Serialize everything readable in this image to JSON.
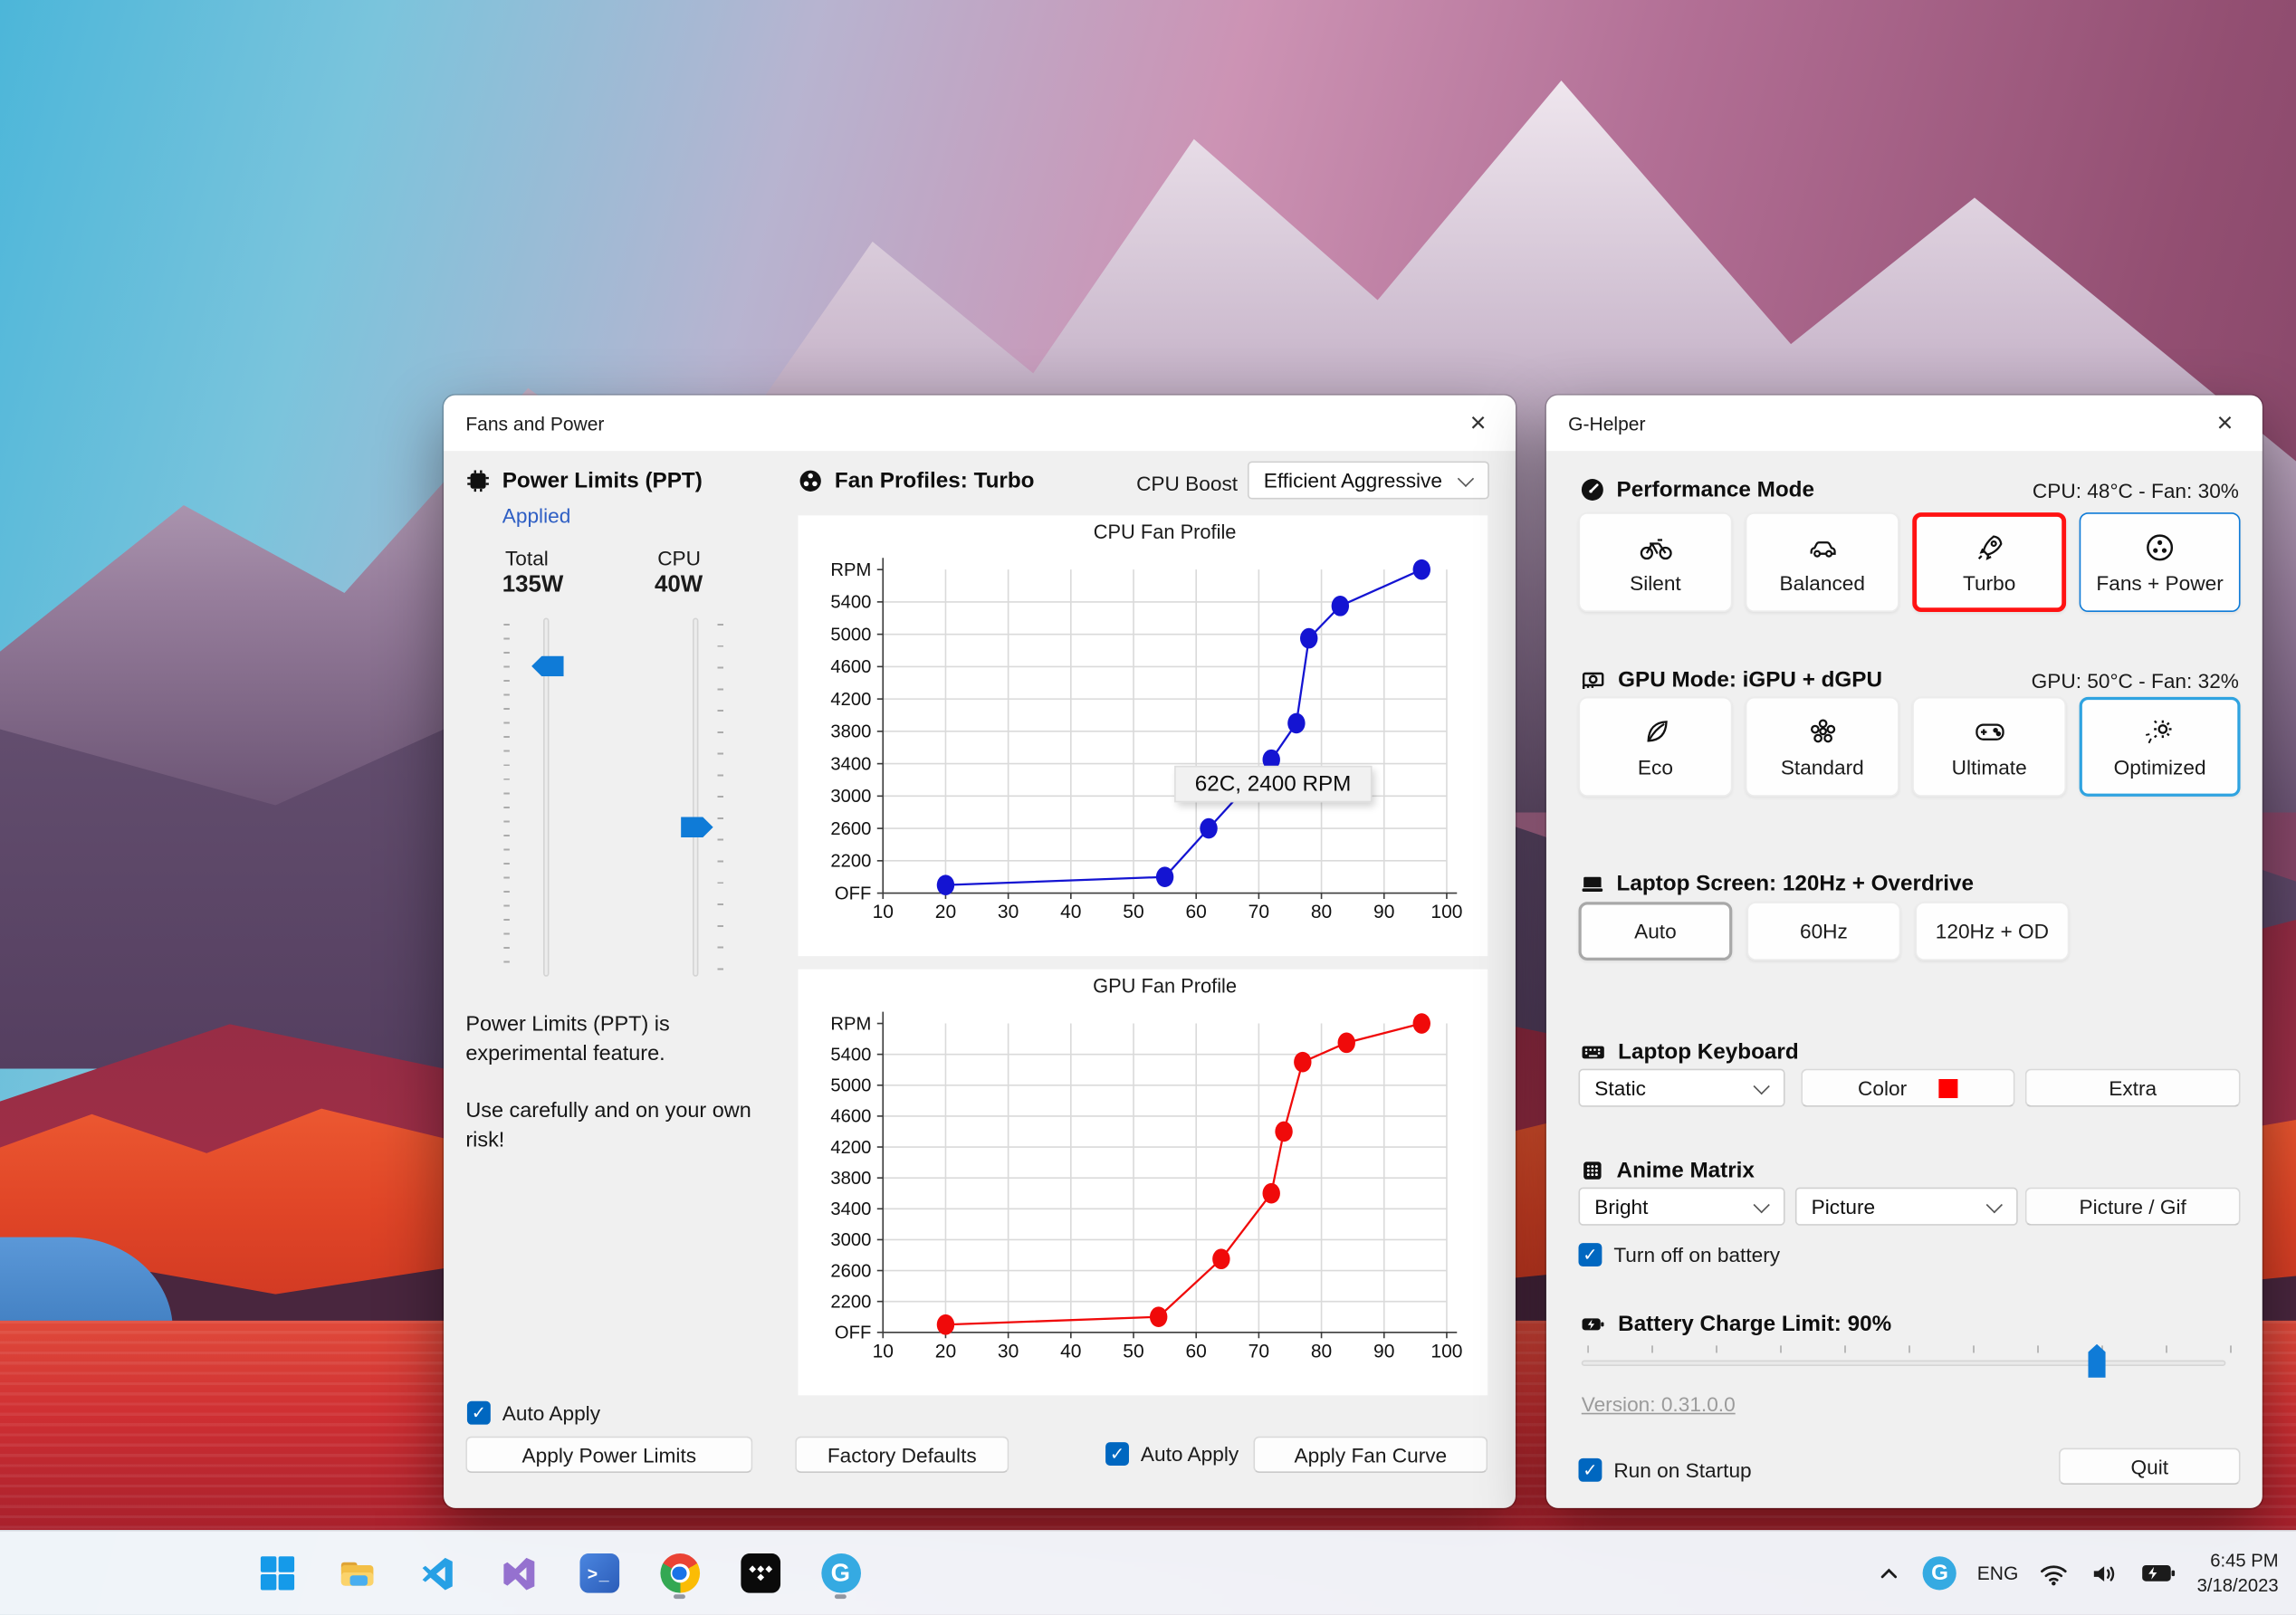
{
  "accent": {
    "blue": "#0f7bd7",
    "checkbox_blue": "#0067c0",
    "selected_red": "#ff1212",
    "selected_blue": "#2fa3e0"
  },
  "fans_window": {
    "title": "Fans and Power",
    "close_glyph": "×",
    "power_limits": {
      "header": "Power Limits (PPT)",
      "status": "Applied",
      "total_label": "Total",
      "total_value": "135W",
      "cpu_label": "CPU",
      "cpu_value": "40W",
      "note1": "Power Limits (PPT) is experimental feature.",
      "note2": "Use carefully and on your own risk!",
      "auto_apply": "Auto Apply",
      "apply_button": "Apply Power Limits"
    },
    "fan_profiles": {
      "header": "Fan Profiles: Turbo",
      "cpu_boost_label": "CPU Boost",
      "cpu_boost_value": "Efficient Aggressive",
      "factory_defaults": "Factory Defaults",
      "auto_apply": "Auto Apply",
      "apply_button": "Apply Fan Curve"
    }
  },
  "chart_data": [
    {
      "id": "cpu",
      "type": "line",
      "title": "CPU Fan Profile",
      "color": "#1414d2",
      "legend_position": "none",
      "grid": true,
      "xlim": [
        10,
        100
      ],
      "ylim": [
        1800,
        5800
      ],
      "x_ticks": [
        10,
        20,
        30,
        40,
        50,
        60,
        70,
        80,
        90,
        100
      ],
      "y_ticks": [
        {
          "v": 1800,
          "label": "OFF"
        },
        {
          "v": 2200,
          "label": "2200"
        },
        {
          "v": 2600,
          "label": "2600"
        },
        {
          "v": 3000,
          "label": "3000"
        },
        {
          "v": 3400,
          "label": "3400"
        },
        {
          "v": 3800,
          "label": "3800"
        },
        {
          "v": 4200,
          "label": "4200"
        },
        {
          "v": 4600,
          "label": "4600"
        },
        {
          "v": 5000,
          "label": "5000"
        },
        {
          "v": 5400,
          "label": "5400"
        },
        {
          "v": 5800,
          "label": "RPM"
        }
      ],
      "points": [
        [
          20,
          1900
        ],
        [
          55,
          2000
        ],
        [
          62,
          2600
        ],
        [
          72,
          3450
        ],
        [
          76,
          3900
        ],
        [
          78,
          4950
        ],
        [
          83,
          5350
        ],
        [
          96,
          5800
        ]
      ],
      "tooltip": "62C, 2400 RPM"
    },
    {
      "id": "gpu",
      "type": "line",
      "title": "GPU Fan Profile",
      "color": "#f00a0a",
      "legend_position": "none",
      "grid": true,
      "xlim": [
        10,
        100
      ],
      "ylim": [
        1800,
        5800
      ],
      "x_ticks": [
        10,
        20,
        30,
        40,
        50,
        60,
        70,
        80,
        90,
        100
      ],
      "y_ticks": [
        {
          "v": 1800,
          "label": "OFF"
        },
        {
          "v": 2200,
          "label": "2200"
        },
        {
          "v": 2600,
          "label": "2600"
        },
        {
          "v": 3000,
          "label": "3000"
        },
        {
          "v": 3400,
          "label": "3400"
        },
        {
          "v": 3800,
          "label": "3800"
        },
        {
          "v": 4200,
          "label": "4200"
        },
        {
          "v": 4600,
          "label": "4600"
        },
        {
          "v": 5000,
          "label": "5000"
        },
        {
          "v": 5400,
          "label": "5400"
        },
        {
          "v": 5800,
          "label": "RPM"
        }
      ],
      "points": [
        [
          20,
          1900
        ],
        [
          54,
          2000
        ],
        [
          64,
          2750
        ],
        [
          72,
          3600
        ],
        [
          74,
          4400
        ],
        [
          77,
          5300
        ],
        [
          84,
          5550
        ],
        [
          96,
          5800
        ]
      ]
    }
  ],
  "ghelper": {
    "title": "G-Helper",
    "close_glyph": "×",
    "performance": {
      "header": "Performance Mode",
      "status": "CPU: 48°C -  Fan: 30%",
      "modes": [
        {
          "label": "Silent",
          "icon": "bicycle-icon"
        },
        {
          "label": "Balanced",
          "icon": "car-icon"
        },
        {
          "label": "Turbo",
          "icon": "rocket-icon",
          "selected": true
        },
        {
          "label": "Fans + Power",
          "icon": "fan-icon",
          "highlighted": true
        }
      ]
    },
    "gpu": {
      "header": "GPU Mode: iGPU + dGPU",
      "status": "GPU: 50°C -  Fan: 32%",
      "modes": [
        {
          "label": "Eco",
          "icon": "leaf-icon"
        },
        {
          "label": "Standard",
          "icon": "flower-icon"
        },
        {
          "label": "Ultimate",
          "icon": "gamepad-icon"
        },
        {
          "label": "Optimized",
          "icon": "auto-gear-icon",
          "selected": true
        }
      ]
    },
    "screen": {
      "header": "Laptop Screen: 120Hz + Overdrive",
      "options": [
        {
          "label": "Auto",
          "selected": true
        },
        {
          "label": "60Hz"
        },
        {
          "label": "120Hz + OD"
        }
      ]
    },
    "keyboard": {
      "header": "Laptop Keyboard",
      "mode_value": "Static",
      "color_label": "Color",
      "color_swatch": "#ff0000",
      "extra_label": "Extra"
    },
    "matrix": {
      "header": "Anime Matrix",
      "brightness_value": "Bright",
      "content_value": "Picture",
      "button_label": "Picture / Gif",
      "checkbox_label": "Turn off on battery"
    },
    "battery": {
      "header": "Battery Charge Limit: 90%"
    },
    "version_link": "Version: 0.31.0.0",
    "startup_label": "Run on Startup",
    "quit_label": "Quit"
  },
  "taskbar": {
    "apps": [
      "start-icon",
      "file-explorer-icon",
      "vscode-icon",
      "visual-studio-icon",
      "terminal-icon",
      "chrome-icon",
      "tidal-icon",
      "ghelper-icon"
    ],
    "tray": {
      "language": "ENG",
      "time": "6:45 PM",
      "date": "3/18/2023"
    }
  }
}
